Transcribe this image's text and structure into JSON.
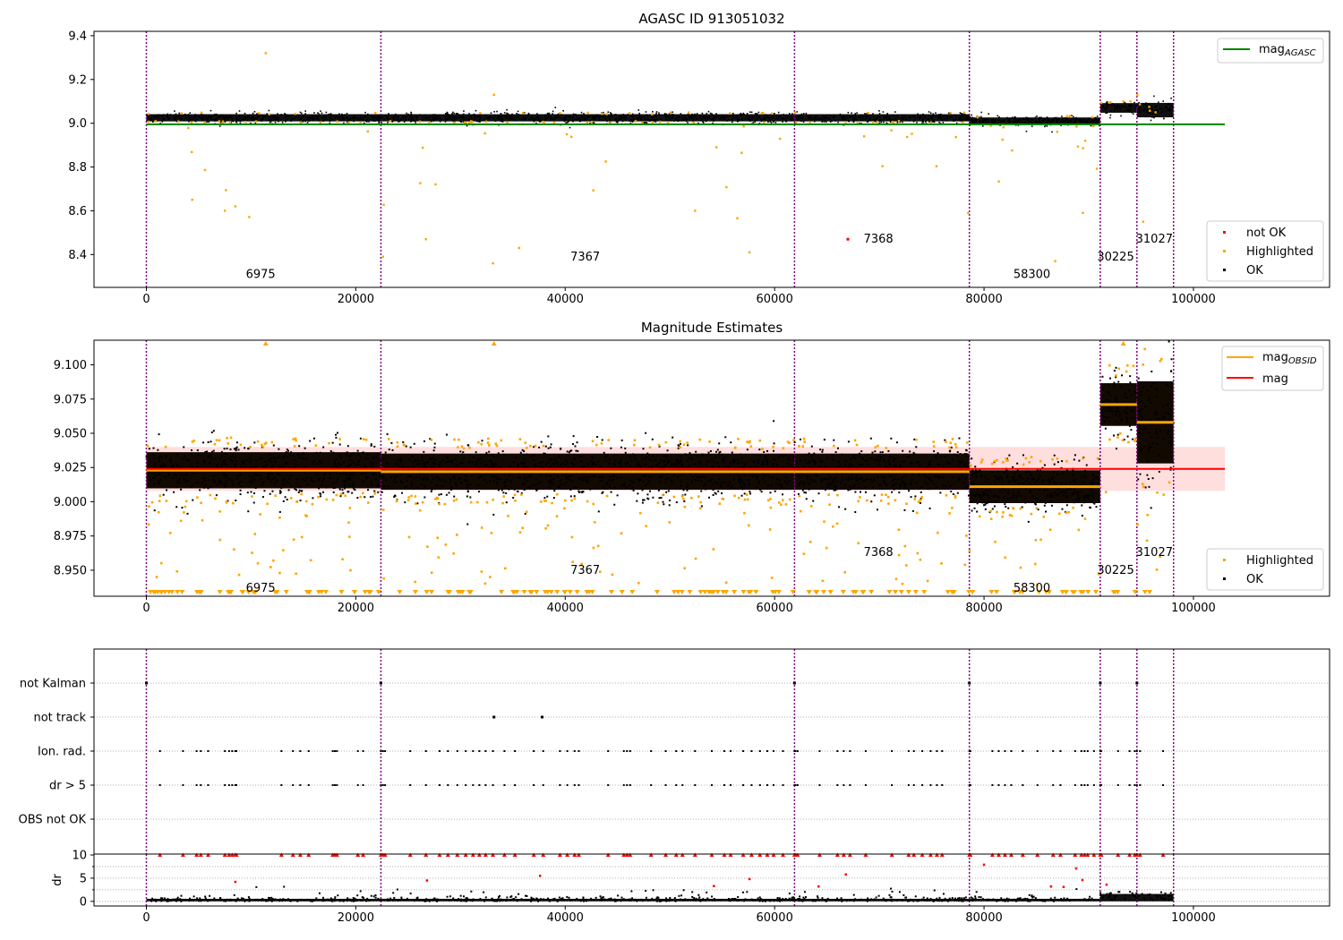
{
  "figure": {
    "background": "#ffffff",
    "colors": {
      "ok": "#000000",
      "highlighted": "#ffa500",
      "not_ok": "#ff0000",
      "obsid_line": "#800080",
      "agasc_line": "#008000",
      "mag_line": "#ff0000",
      "mag_band": "#ffb6b6",
      "mag_obsid_line": "#ffa500"
    }
  },
  "chart_data": [
    {
      "type": "scatter",
      "title": "AGASC ID 913051032",
      "xlim": [
        -5000,
        113000
      ],
      "ylim": [
        8.25,
        9.42
      ],
      "xticks": [
        0,
        20000,
        40000,
        60000,
        80000,
        100000
      ],
      "yticks": [
        8.4,
        8.6,
        8.8,
        9.0,
        9.2,
        9.4
      ],
      "ytick_labels": [
        "8.4",
        "8.6",
        "8.8",
        "9.0",
        "9.2",
        "9.4"
      ],
      "obsid_boundaries": [
        0,
        22400,
        61900,
        78600,
        91100,
        94600,
        98100
      ],
      "segments": [
        {
          "x0": 0,
          "x1": 22400,
          "level": 9.025,
          "spread": 0.03
        },
        {
          "x0": 22400,
          "x1": 61900,
          "level": 9.025,
          "spread": 0.03
        },
        {
          "x0": 61900,
          "x1": 78600,
          "level": 9.025,
          "spread": 0.03
        },
        {
          "x0": 78600,
          "x1": 91100,
          "level": 9.01,
          "spread": 0.03
        },
        {
          "x0": 91100,
          "x1": 94600,
          "level": 9.07,
          "spread": 0.04
        },
        {
          "x0": 94600,
          "x1": 98100,
          "level": 9.06,
          "spread": 0.06
        }
      ],
      "mag_agasc": {
        "y": 8.995,
        "x0": 0,
        "x1": 103000
      },
      "not_ok_points": [
        {
          "x": 67000,
          "y": 8.47
        }
      ],
      "obsid_labels": [
        {
          "text": "6975",
          "x": 9500,
          "y": 8.31
        },
        {
          "text": "7367",
          "x": 40500,
          "y": 8.39
        },
        {
          "text": "7368",
          "x": 68500,
          "y": 8.47
        },
        {
          "text": "58300",
          "x": 82800,
          "y": 8.31
        },
        {
          "text": "30225",
          "x": 90800,
          "y": 8.39
        },
        {
          "text": "31027",
          "x": 94500,
          "y": 8.47
        }
      ],
      "legend": {
        "upper": {
          "position": "upper-right",
          "entries": [
            {
              "label": "mag",
              "sub": "AGASC",
              "kind": "line",
              "color": "#008000"
            }
          ]
        },
        "lower": {
          "position": "lower-right",
          "entries": [
            {
              "label": "not OK",
              "kind": "dot",
              "color": "#ff0000"
            },
            {
              "label": "Highlighted",
              "kind": "dot",
              "color": "#ffa500"
            },
            {
              "label": "OK",
              "kind": "dot",
              "color": "#000000"
            }
          ]
        }
      }
    },
    {
      "type": "scatter",
      "title": "Magnitude Estimates",
      "xlim": [
        -5000,
        113000
      ],
      "ylim": [
        8.931,
        9.118
      ],
      "xticks": [
        0,
        20000,
        40000,
        60000,
        80000,
        100000
      ],
      "yticks": [
        8.95,
        8.975,
        9.0,
        9.025,
        9.05,
        9.075,
        9.1
      ],
      "ytick_labels": [
        "8.950",
        "8.975",
        "9.000",
        "9.025",
        "9.050",
        "9.075",
        "9.100"
      ],
      "obsid_boundaries": [
        0,
        22400,
        61900,
        78600,
        91100,
        94600,
        98100
      ],
      "mag": {
        "y": 9.024,
        "band": [
          9.008,
          9.04
        ],
        "x0": 0,
        "x1": 103000
      },
      "mag_obsid": [
        {
          "x0": 0,
          "x1": 22400,
          "y": 9.023,
          "band": [
            9.013,
            9.033
          ]
        },
        {
          "x0": 22400,
          "x1": 61900,
          "y": 9.022,
          "band": [
            9.012,
            9.032
          ]
        },
        {
          "x0": 61900,
          "x1": 78600,
          "y": 9.022,
          "band": [
            9.012,
            9.032
          ]
        },
        {
          "x0": 78600,
          "x1": 91100,
          "y": 9.011,
          "band": [
            9.001,
            9.021
          ]
        },
        {
          "x0": 91100,
          "x1": 94600,
          "y": 9.071,
          "band": [
            9.057,
            9.085
          ]
        },
        {
          "x0": 94600,
          "x1": 98100,
          "y": 9.058,
          "band": [
            9.04,
            9.076
          ]
        }
      ],
      "segments": [
        {
          "x0": 0,
          "x1": 22400,
          "level": 9.023,
          "spread": 0.022
        },
        {
          "x0": 22400,
          "x1": 61900,
          "level": 9.022,
          "spread": 0.022
        },
        {
          "x0": 61900,
          "x1": 78600,
          "level": 9.022,
          "spread": 0.022
        },
        {
          "x0": 78600,
          "x1": 91100,
          "level": 9.011,
          "spread": 0.02
        },
        {
          "x0": 91100,
          "x1": 94600,
          "level": 9.071,
          "spread": 0.026
        },
        {
          "x0": 94600,
          "x1": 98100,
          "level": 9.058,
          "spread": 0.05
        }
      ],
      "obsid_labels": [
        {
          "text": "6975",
          "x": 9500,
          "y": 8.937
        },
        {
          "text": "7367",
          "x": 40500,
          "y": 8.95
        },
        {
          "text": "7368",
          "x": 68500,
          "y": 8.963
        },
        {
          "text": "58300",
          "x": 82800,
          "y": 8.937
        },
        {
          "text": "30225",
          "x": 90800,
          "y": 8.95
        },
        {
          "text": "31027",
          "x": 94500,
          "y": 8.963
        }
      ],
      "legend": {
        "upper": {
          "position": "upper-right",
          "entries": [
            {
              "label": "mag",
              "sub": "OBSID",
              "kind": "line",
              "color": "#ffa500"
            },
            {
              "label": "mag",
              "kind": "line",
              "color": "#ff0000"
            }
          ]
        },
        "lower": {
          "position": "lower-right",
          "entries": [
            {
              "label": "Highlighted",
              "kind": "dot",
              "color": "#ffa500"
            },
            {
              "label": "OK",
              "kind": "dot",
              "color": "#000000"
            }
          ]
        }
      }
    },
    {
      "type": "scatter",
      "title": "",
      "xlim": [
        -5000,
        113000
      ],
      "categories": [
        "not Kalman",
        "not track",
        "Ion. rad.",
        "dr > 5",
        "OBS not OK"
      ],
      "obsid_boundaries": [
        0,
        22400,
        61900,
        78600,
        91100,
        94600,
        98100
      ],
      "flags": {
        "not Kalman": [
          0,
          22400,
          61900,
          78600,
          91100,
          94600
        ],
        "not track": [
          33200,
          37800
        ]
      },
      "ion_rad_x": [
        1300,
        3500,
        4800,
        5200,
        5900,
        7500,
        7900,
        8200,
        8500,
        8600,
        12900,
        14000,
        14700,
        15500,
        17800,
        18000,
        18200,
        20200,
        20700,
        22400,
        22600,
        22800,
        25200,
        26700,
        28000,
        28800,
        29700,
        30500,
        31200,
        31800,
        32400,
        33100,
        34200,
        35200,
        37000,
        37900,
        39500,
        40200,
        40900,
        41300,
        44100,
        45600,
        45900,
        46200,
        48200,
        49600,
        50600,
        51200,
        52400,
        54000,
        55200,
        55800,
        57000,
        57800,
        58600,
        59300,
        59900,
        60800,
        61900,
        62000,
        62200,
        64300,
        66000,
        66600,
        67200,
        68700,
        71200,
        72800,
        73300,
        74100,
        74900,
        75500,
        76000,
        78600,
        78700,
        80800,
        81400,
        82000,
        82600,
        83700,
        85100,
        86600,
        87300,
        88700,
        89300,
        89600,
        89900,
        90500,
        91100,
        91200,
        92800,
        93900,
        94400,
        94600,
        94900,
        97100
      ]
    },
    {
      "type": "scatter",
      "title": "",
      "xlim": [
        -5000,
        113000
      ],
      "ylabel": "dr",
      "ylim": [
        -1,
        10.2
      ],
      "xticks": [
        0,
        20000,
        40000,
        60000,
        80000,
        100000
      ],
      "yticks": [
        0,
        5,
        10
      ],
      "ytick_labels": [
        "0",
        "5",
        "10"
      ],
      "obsid_boundaries": [
        0,
        22400,
        61900,
        78600,
        91100,
        94600,
        98100
      ],
      "scattered_red": [
        {
          "x": 8500,
          "y": 4.2
        },
        {
          "x": 26800,
          "y": 4.5
        },
        {
          "x": 37600,
          "y": 5.5
        },
        {
          "x": 54200,
          "y": 3.3
        },
        {
          "x": 57600,
          "y": 4.8
        },
        {
          "x": 64200,
          "y": 3.2
        },
        {
          "x": 66800,
          "y": 5.8
        },
        {
          "x": 80000,
          "y": 7.9
        },
        {
          "x": 86400,
          "y": 3.2
        },
        {
          "x": 87600,
          "y": 3.1
        },
        {
          "x": 88800,
          "y": 7.1
        },
        {
          "x": 89400,
          "y": 4.6
        },
        {
          "x": 91700,
          "y": 3.6
        }
      ]
    }
  ]
}
